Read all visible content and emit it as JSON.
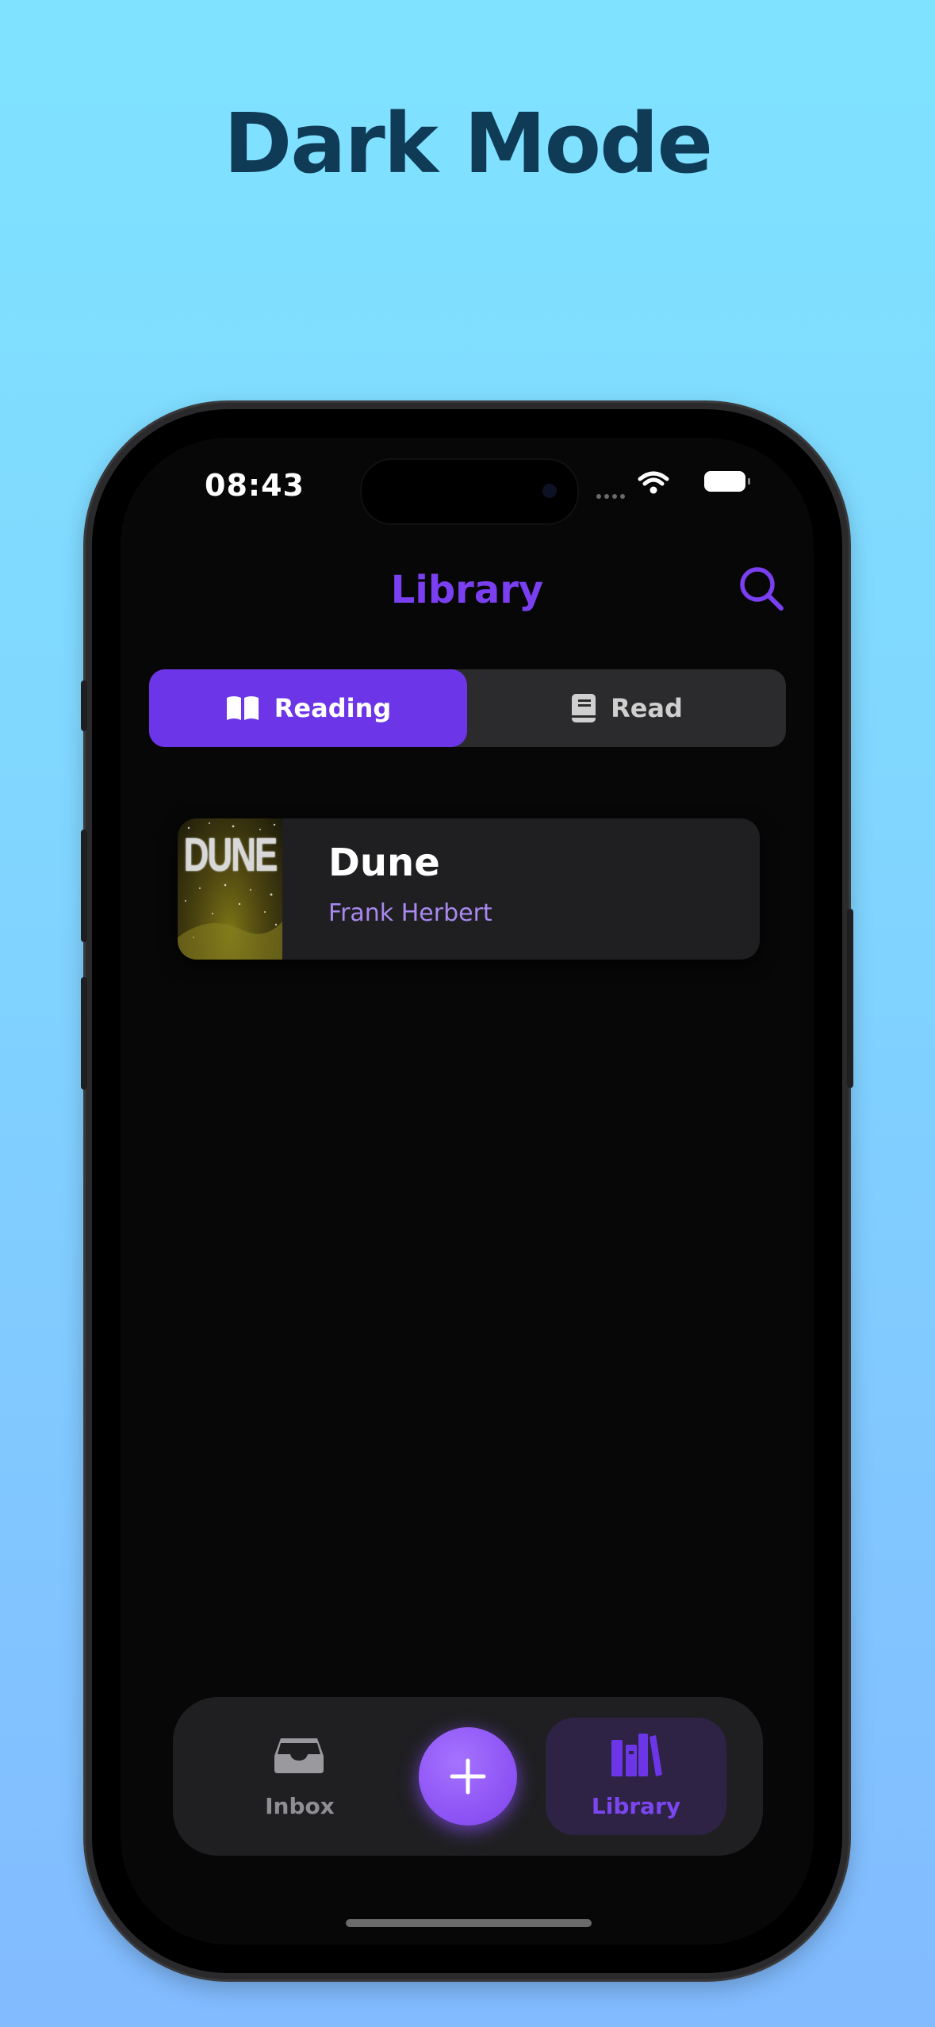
{
  "headline": "Dark Mode",
  "status_bar": {
    "time": "08:43"
  },
  "nav": {
    "title": "Library",
    "search_icon": "search-icon"
  },
  "segments": [
    {
      "label": "Reading",
      "icon": "open-book-icon",
      "selected": true
    },
    {
      "label": "Read",
      "icon": "closed-book-icon",
      "selected": false
    }
  ],
  "books": [
    {
      "title": "Dune",
      "author": "Frank Herbert",
      "cover_text": "DUNE"
    }
  ],
  "tab_bar": {
    "items": [
      {
        "label": "Inbox",
        "icon": "inbox-tray-icon",
        "selected": false
      },
      {
        "label": "Library",
        "icon": "library-books-icon",
        "selected": true
      }
    ],
    "add_button_icon": "plus-icon"
  },
  "colors": {
    "accent": "#6c36e8",
    "accent_text": "#7b46f0",
    "author_text": "#a889f0",
    "screen_background": "#070707",
    "card_background": "#1f1f21",
    "headline": "#0f3b57"
  }
}
